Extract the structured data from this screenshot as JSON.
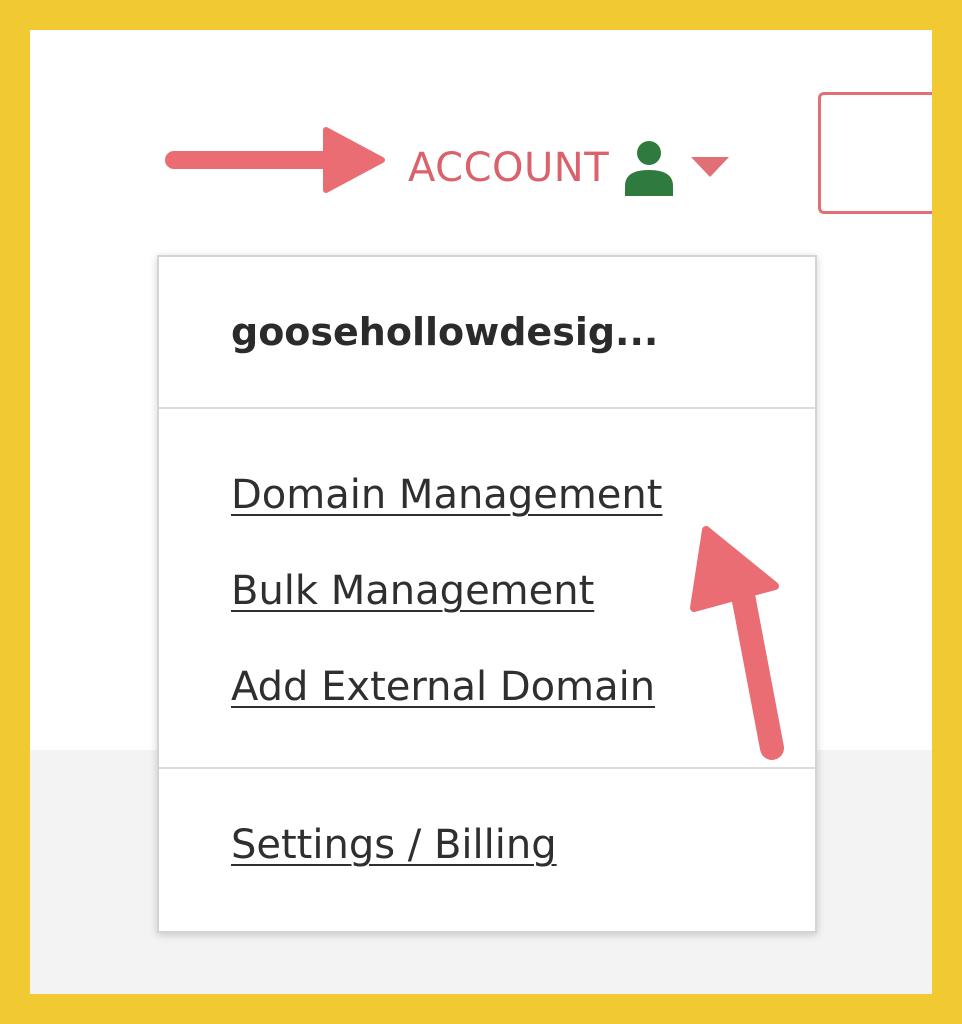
{
  "header": {
    "account_label": "ACCOUNT",
    "user_icon": "user-icon",
    "caret_icon": "caret-down-icon"
  },
  "dropdown": {
    "username": "goosehollowdesig...",
    "domain_links": [
      {
        "label": "Domain Management"
      },
      {
        "label": "Bulk Management"
      },
      {
        "label": "Add External Domain"
      }
    ],
    "footer_link": {
      "label": "Settings / Billing"
    }
  },
  "colors": {
    "frame": "#f1c932",
    "accent": "#d9626b",
    "user_icon": "#2f7a3e",
    "annotation_arrow": "#ea6d74",
    "link_text": "#2f2f2f"
  }
}
